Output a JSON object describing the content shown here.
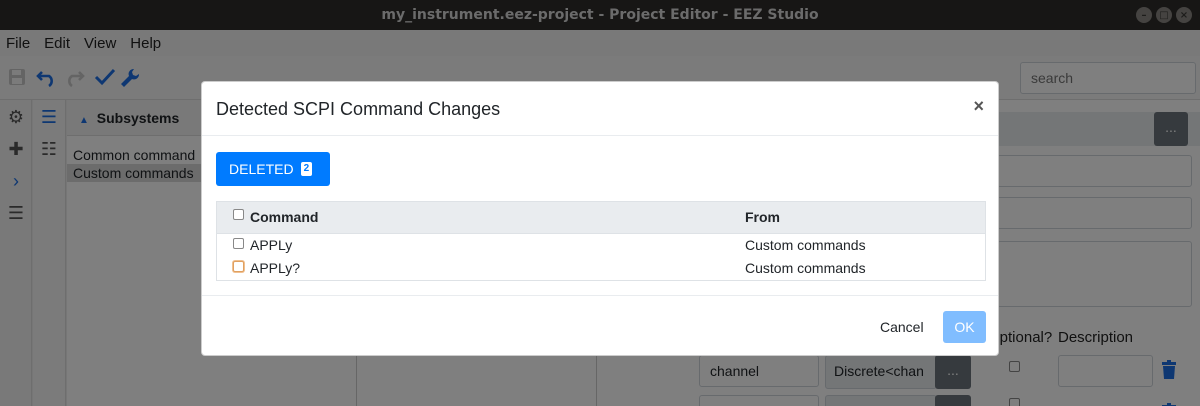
{
  "window": {
    "title": "my_instrument.eez-project - Project Editor - EEZ Studio"
  },
  "menubar": {
    "items": [
      "File",
      "Edit",
      "View",
      "Help"
    ]
  },
  "toolbar": {
    "icons": [
      "save-icon",
      "undo-icon",
      "redo-icon",
      "check-icon",
      "wrench-icon"
    ],
    "search_placeholder": "search"
  },
  "subsystems_panel": {
    "title": "Subsystems",
    "items": [
      "Common command",
      "Custom commands"
    ]
  },
  "right_panel": {
    "columns": [
      "Optional?",
      "Description"
    ],
    "param_rows": [
      {
        "name": "channel",
        "type": "Discrete<chan",
        "more": "..."
      },
      {
        "name": "",
        "type": "",
        "more": "..."
      }
    ],
    "top_more": "..."
  },
  "modal": {
    "title": "Detected SCPI Command Changes",
    "close_label": "×",
    "tab": {
      "label": "DELETED",
      "count": "2"
    },
    "table": {
      "headers": [
        "Command",
        "From"
      ],
      "rows": [
        {
          "command": "APPLy",
          "from": "Custom commands",
          "checked": false
        },
        {
          "command": "APPLy?",
          "from": "Custom commands",
          "checked": false
        }
      ]
    },
    "cancel_label": "Cancel",
    "ok_label": "OK"
  },
  "colors": {
    "primary": "#007bff",
    "primary_disabled": "#80bdff",
    "titlebar": "#2e2d2a",
    "icon_blue": "#1d6fe5",
    "delete_icon": "#1d6fe5"
  }
}
